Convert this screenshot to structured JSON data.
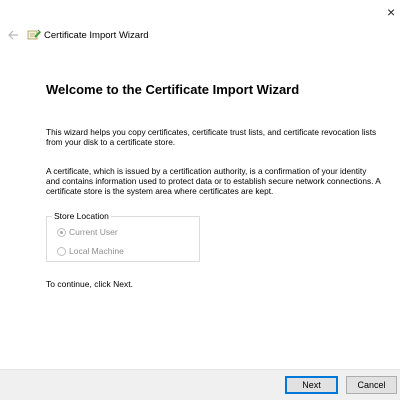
{
  "window": {
    "title": "Certificate Import Wizard",
    "close_glyph": "×",
    "icon": "certificate-icon"
  },
  "nav": {
    "back_icon": "back-arrow-icon"
  },
  "main": {
    "heading": "Welcome to the Certificate Import Wizard",
    "paragraph1": "This wizard helps you copy certificates, certificate trust lists, and certificate revocation lists from your disk to a certificate store.",
    "paragraph2": "A certificate, which is issued by a certification authority, is a confirmation of your identity and contains information used to protect data or to establish secure network connections. A certificate store is the system area where certificates are kept.",
    "store_location": {
      "label": "Store Location",
      "options": [
        {
          "label": "Current User",
          "selected": true,
          "enabled": false
        },
        {
          "label": "Local Machine",
          "selected": false,
          "enabled": false
        }
      ]
    },
    "continue_text": "To continue, click Next."
  },
  "footer": {
    "next_label": "Next",
    "cancel_label": "Cancel"
  },
  "colors": {
    "accent": "#0078d7",
    "footer_bg": "#f0f0f0",
    "disabled_text": "#8e8e8e"
  }
}
